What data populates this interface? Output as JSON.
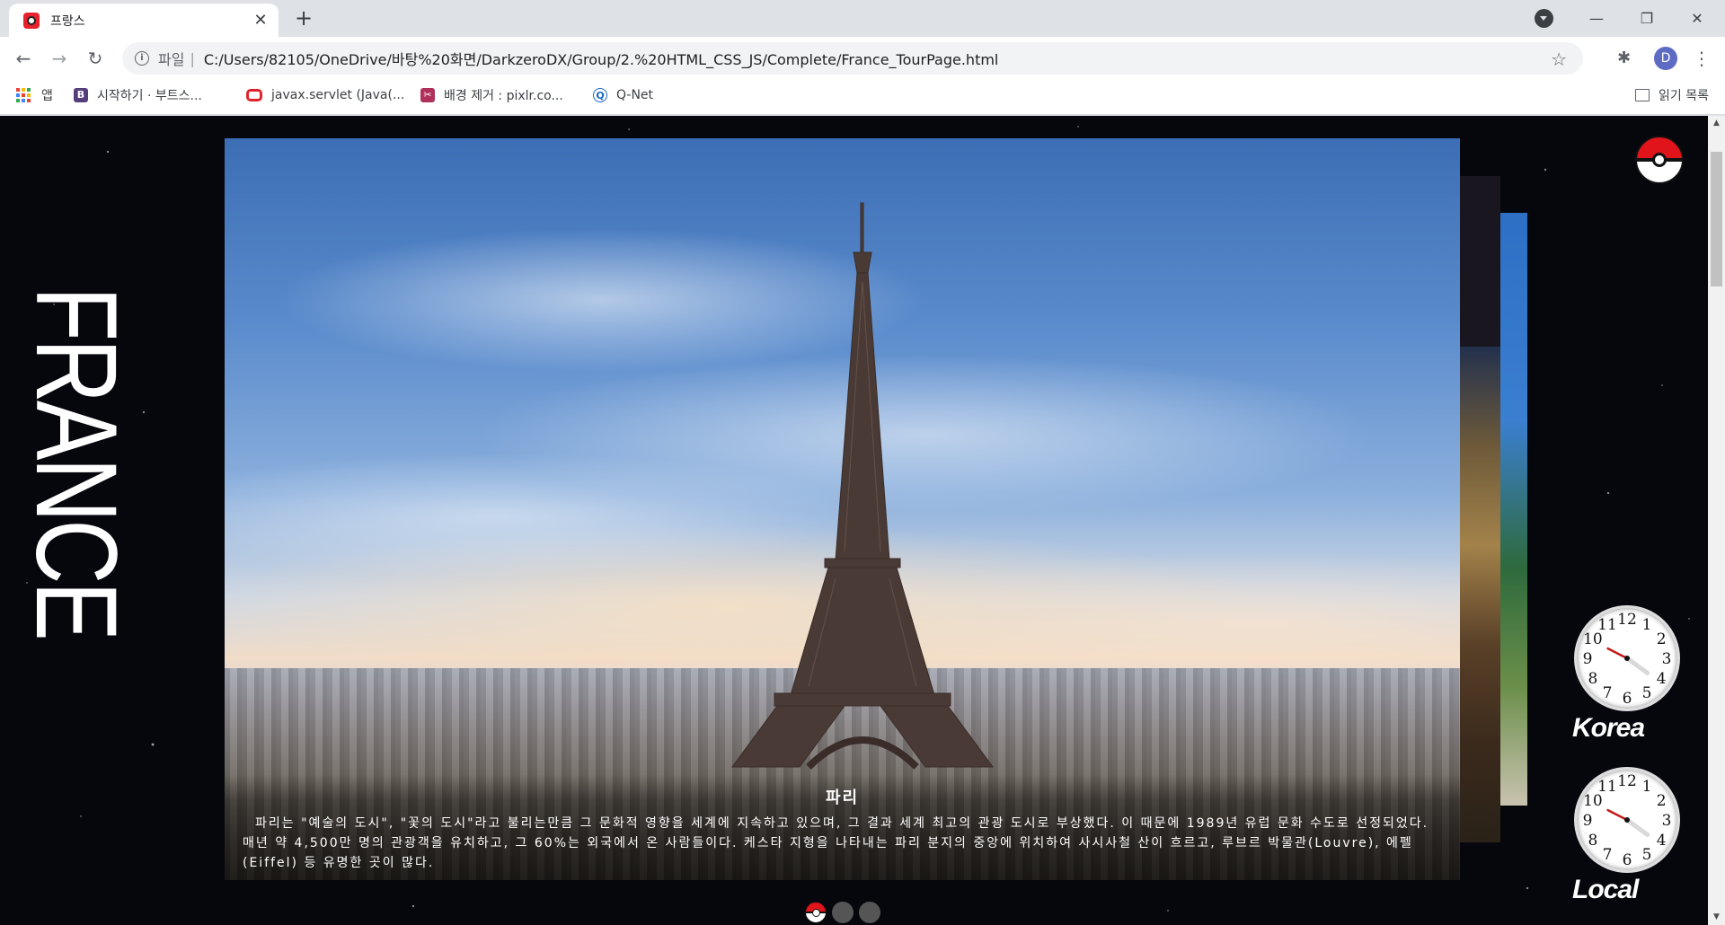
{
  "browser": {
    "tab_title": "프랑스",
    "new_tab": "+",
    "tab_close": "✕",
    "minimize": "—",
    "restore": "❐",
    "close": "✕",
    "url_scheme": "파일",
    "url_separator": "|",
    "url": "C:/Users/82105/OneDrive/바탕%20화면/DarkzeroDX/Group/2.%20HTML_CSS_JS/Complete/France_TourPage.html",
    "profile_initial": "D",
    "back": "←",
    "forward": "→",
    "reload": "↻",
    "star": "☆",
    "menu": "⋮",
    "info": "i",
    "extensions": "✱"
  },
  "bookmarks": {
    "items": [
      {
        "label": "앱",
        "icon": "apps-grid-icon"
      },
      {
        "label": "시작하기 · 부트스...",
        "icon": "bootstrap-b-icon",
        "icon_char": "B",
        "color": "#563d7c"
      },
      {
        "label": "javax.servlet (Java(...",
        "icon": "oracle-icon",
        "color": "#e0242b"
      },
      {
        "label": "배경 제거 : pixlr.co...",
        "icon": "pixlr-icon",
        "icon_char": "✂",
        "color": "#b0305c"
      },
      {
        "label": "Q-Net",
        "icon": "qnet-icon",
        "icon_char": "Q",
        "color": "#1b67c7"
      }
    ],
    "reading_list": "읽기 목록"
  },
  "page": {
    "heading": "FRANCE",
    "slide": {
      "title": "파리",
      "description": "파리는 \"예술의 도시\", \"꽃의 도시\"라고 불리는만큼 그 문화적 영향을 세계에 지속하고 있으며, 그 결과 세계 최고의 관광 도시로 부상했다. 이 때문에 1989년 유럽 문화 수도로 선정되었다. 매년 약 4,500만 명의 관광객을 유치하고, 그 60%는 외국에서 온 사람들이다. 케스타 지형을 나타내는 파리 분지의 중앙에 위치하여 사시사철 산이 흐르고, 루브르 박물관(Louvre), 에펠(Eiffel) 등 유명한 곳이 많다."
    },
    "clocks": [
      {
        "label": "Korea",
        "hour": 9.9,
        "minute": 21
      },
      {
        "label": "Local",
        "hour": 9.9,
        "minute": 21
      }
    ],
    "pagination": {
      "count": 3,
      "active": 0
    },
    "colors": {
      "background": "#05070d",
      "pokeball_red": "#e1141b"
    }
  }
}
